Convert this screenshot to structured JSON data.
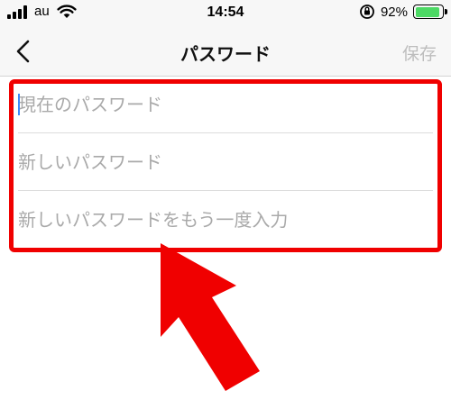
{
  "status_bar": {
    "carrier": "au",
    "time": "14:54",
    "battery_percent": "92%",
    "battery_level": 0.92,
    "battery_color": "#4cd964",
    "icons": [
      "signal-icon",
      "wifi-icon",
      "orientation-lock-icon",
      "battery-icon",
      "charging-bolt-icon"
    ]
  },
  "nav": {
    "title": "パスワード",
    "save_label": "保存",
    "back_icon": "chevron-left-icon"
  },
  "form": {
    "fields": [
      {
        "placeholder": "現在のパスワード",
        "value": ""
      },
      {
        "placeholder": "新しいパスワード",
        "value": ""
      },
      {
        "placeholder": "新しいパスワードをもう一度入力",
        "value": ""
      }
    ]
  },
  "annotation": {
    "highlight_color": "#f00000",
    "arrow_color": "#f00000"
  }
}
